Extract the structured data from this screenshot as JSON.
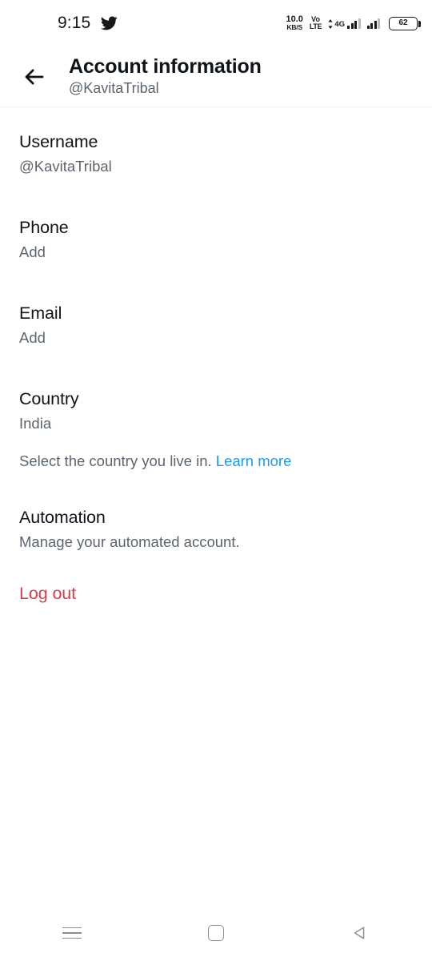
{
  "statusbar": {
    "time": "9:15",
    "app_icon": "twitter-bird-icon",
    "network_speed_value": "10.0",
    "network_speed_unit": "KB/S",
    "volte_line1": "Vo",
    "volte_line2": "LTE",
    "network_type": "4G",
    "battery_level": "62"
  },
  "appbar": {
    "back_icon": "back-arrow-icon",
    "title": "Account information",
    "subtitle": "@KavitaTribal"
  },
  "settings": {
    "username": {
      "label": "Username",
      "value": "@KavitaTribal"
    },
    "phone": {
      "label": "Phone",
      "value": "Add"
    },
    "email": {
      "label": "Email",
      "value": "Add"
    },
    "country": {
      "label": "Country",
      "value": "India",
      "help_text": "Select the country you live in. ",
      "help_link": "Learn more"
    },
    "automation": {
      "label": "Automation",
      "value": "Manage your automated account."
    },
    "logout": {
      "label": "Log out"
    }
  },
  "navbar": {
    "recents": "recents-icon",
    "home": "home-icon",
    "back": "back-icon"
  },
  "colors": {
    "primary_text": "#0f1419",
    "secondary_text": "#5b6570",
    "link": "#1d9bf0",
    "danger": "#d93a4e",
    "divider": "#eff3f4",
    "background": "#ffffff"
  }
}
